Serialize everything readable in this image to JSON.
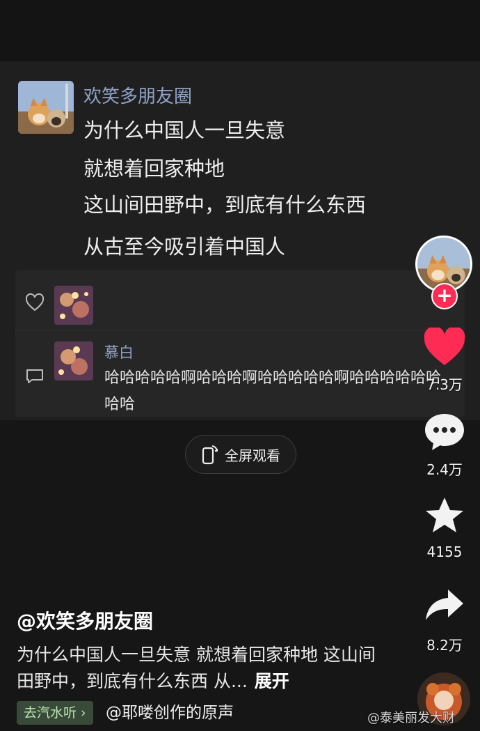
{
  "post": {
    "author": "欢笑多朋友圈",
    "lines": [
      "为什么中国人一旦失意",
      "就想着回家种地",
      "这山间田野中，到底有什么东西",
      "从古至今吸引着中国人"
    ]
  },
  "comment": {
    "name": "慕白",
    "text": "哈哈哈哈哈啊哈哈哈啊哈哈哈哈哈啊哈哈哈哈哈哈哈哈"
  },
  "fullscreen_label": "全屏观看",
  "rail": {
    "likes": "7.3万",
    "comments": "2.4万",
    "favorites": "4155",
    "shares": "8.2万"
  },
  "video": {
    "handle": "@欢笑多朋友圈",
    "caption": "为什么中国人一旦失意 就想着回家种地 这山间田野中，到底有什么东西 从...",
    "expand_label": "展开",
    "listen_chip": "去汽水听 ›",
    "sound": "@耶喽创作的原声"
  },
  "watermark": "@泰美丽发大财",
  "colors": {
    "accent": "#fe2c55",
    "link": "#8fa3c7"
  }
}
